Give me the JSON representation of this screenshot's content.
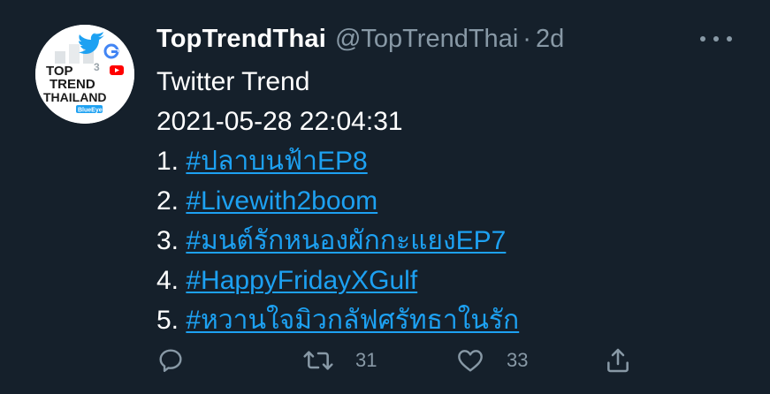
{
  "tweet": {
    "display_name": "TopTrendThai",
    "handle": "@TopTrendThai",
    "separator": "·",
    "time": "2d",
    "avatar": {
      "line1": "TOP",
      "line2": "TREND",
      "line3": "THAILAND",
      "badge": "BlueEye",
      "colors": {
        "background": "#ffffff",
        "text": "#1a1a1a",
        "accent_red": "#e0245e",
        "badge_blue": "#1da1f2"
      }
    },
    "title": "Twitter Trend",
    "timestamp": "2021-05-28 22:04:31",
    "trends": [
      {
        "rank": "1.",
        "tag": "#ปลาบนฟ้าEP8"
      },
      {
        "rank": "2.",
        "tag": "#Livewith2boom"
      },
      {
        "rank": "3.",
        "tag": "#มนต์รักหนองผักกะแยงEP7"
      },
      {
        "rank": "4.",
        "tag": "#HappyFridayXGulf"
      },
      {
        "rank": "5.",
        "tag": "#หวานใจมิวกลัฟศรัทธาในรัก"
      }
    ]
  },
  "actions": {
    "reply_icon": "reply-icon",
    "retweet_icon": "retweet-icon",
    "retweet_count": "31",
    "like_icon": "heart-icon",
    "like_count": "33",
    "share_icon": "share-icon"
  },
  "colors": {
    "background": "#15202b",
    "text": "#ffffff",
    "muted": "#8899a6",
    "link": "#1da1f2"
  }
}
